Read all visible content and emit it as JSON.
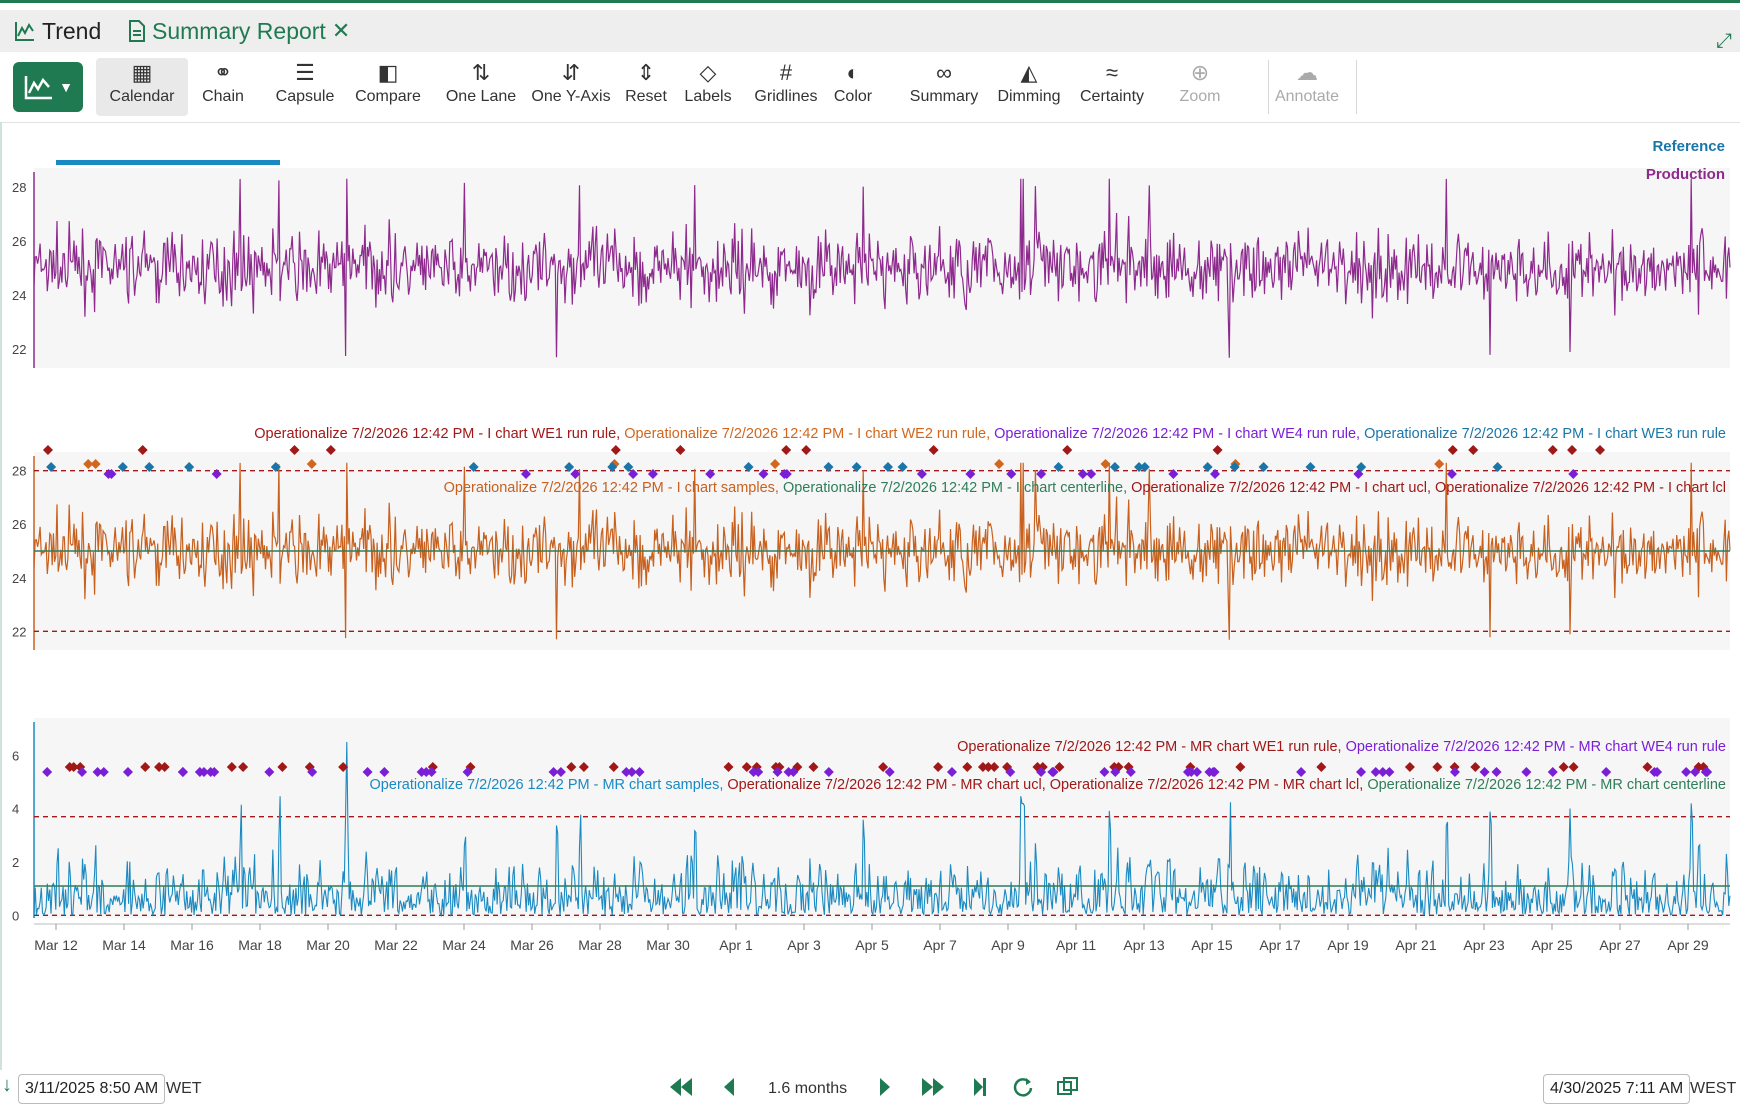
{
  "tabs": [
    {
      "label": "Trend"
    },
    {
      "label": "Summary Report"
    }
  ],
  "toolbar": {
    "items": [
      {
        "label": "Calendar",
        "icon": "calendar-icon"
      },
      {
        "label": "Chain",
        "icon": "chain-icon"
      },
      {
        "label": "Capsule",
        "icon": "capsule-icon"
      },
      {
        "label": "Compare",
        "icon": "compare-icon"
      },
      {
        "label": "One Lane",
        "icon": "one-lane-icon"
      },
      {
        "label": "One Y-Axis",
        "icon": "one-y-axis-icon"
      },
      {
        "label": "Reset",
        "icon": "reset-icon"
      },
      {
        "label": "Labels",
        "icon": "labels-icon"
      },
      {
        "label": "Gridlines",
        "icon": "gridlines-icon"
      },
      {
        "label": "Color",
        "icon": "color-icon"
      },
      {
        "label": "Summary",
        "icon": "summary-icon"
      },
      {
        "label": "Dimming",
        "icon": "dimming-icon"
      },
      {
        "label": "Certainty",
        "icon": "certainty-icon"
      },
      {
        "label": "Zoom",
        "icon": "zoom-icon"
      },
      {
        "label": "Annotate",
        "icon": "annotate-icon"
      }
    ]
  },
  "trend": {
    "reference_label": "Reference",
    "production_label": "Production"
  },
  "lanes": {
    "i_legend_top": [
      {
        "text": "Operationalize 7/2/2026 12:42 PM - I chart WE1 run rule,",
        "color": "#a01818"
      },
      {
        "text": " Operationalize 7/2/2026 12:42 PM - I chart WE2 run rule,",
        "color": "#d2661c"
      },
      {
        "text": " Operationalize 7/2/2026 12:42 PM - I chart WE4 run rule,",
        "color": "#7a1fd6"
      },
      {
        "text": " Operationalize 7/2/2026 12:42 PM - I chart WE3 run rule",
        "color": "#1a76a8"
      }
    ],
    "i_legend_bottom": [
      {
        "text": "Operationalize 7/2/2026 12:42 PM - I chart samples,",
        "color": "#c8601e"
      },
      {
        "text": " Operationalize 7/2/2026 12:42 PM - I chart centerline,",
        "color": "#2f7d5a"
      },
      {
        "text": " Operationalize 7/2/2026 12:42 PM - I chart ucl,",
        "color": "#a01818"
      },
      {
        "text": " Operationalize 7/2/2026 12:42 PM - I chart lcl",
        "color": "#a01818"
      }
    ],
    "mr_legend_top": [
      {
        "text": "Operationalize 7/2/2026 12:42 PM - MR chart WE1 run rule,",
        "color": "#a01818"
      },
      {
        "text": " Operationalize 7/2/2026 12:42 PM - MR chart WE4 run rule",
        "color": "#7a1fd6"
      }
    ],
    "mr_legend_bottom": [
      {
        "text": "Operationalize 7/2/2026 12:42 PM - MR chart samples,",
        "color": "#1a8ac2"
      },
      {
        "text": " Operationalize 7/2/2026 12:42 PM - MR chart ucl,",
        "color": "#a01818"
      },
      {
        "text": " Operationalize 7/2/2026 12:42 PM - MR chart lcl,",
        "color": "#a01818"
      },
      {
        "text": " Operationalize 7/2/2026 12:42 PM - MR chart centerline",
        "color": "#2f7d5a"
      }
    ]
  },
  "chart_data": [
    {
      "type": "line",
      "series": [
        {
          "name": "Production",
          "color": "#8e2a8e",
          "center": 25,
          "spread": 3.2,
          "min": 21,
          "max": 28.2
        }
      ],
      "ylim": [
        21.3,
        28.7
      ],
      "yticks": [
        22,
        24,
        26,
        28
      ]
    },
    {
      "type": "line",
      "series": [
        {
          "name": "Operationalize 7/2/2026 12:42 PM - I chart samples",
          "color": "#c8601e",
          "center": 25,
          "spread": 3.2,
          "min": 21,
          "max": 28.2
        }
      ],
      "ylim": [
        21.3,
        28.7
      ],
      "yticks": [
        22,
        24,
        26,
        28
      ],
      "centerline": 25,
      "ucl": 28,
      "lcl": 22
    },
    {
      "type": "line",
      "series": [
        {
          "name": "Operationalize 7/2/2026 12:42 PM - MR chart samples",
          "color": "#1a8ac2",
          "max": 6.5
        }
      ],
      "ylim": [
        -0.1,
        7.4
      ],
      "yticks": [
        0,
        2,
        4,
        6
      ],
      "centerline": 1.1,
      "ucl": 3.7,
      "lcl": 0
    }
  ],
  "x_axis": {
    "ticks": [
      "Mar 12",
      "Mar 14",
      "Mar 16",
      "Mar 18",
      "Mar 20",
      "Mar 22",
      "Mar 24",
      "Mar 26",
      "Mar 28",
      "Mar 30",
      "Apr 1",
      "Apr 3",
      "Apr 5",
      "Apr 7",
      "Apr 9",
      "Apr 11",
      "Apr 13",
      "Apr 15",
      "Apr 17",
      "Apr 19",
      "Apr 21",
      "Apr 23",
      "Apr 25",
      "Apr 27",
      "Apr 29"
    ]
  },
  "footer": {
    "start": "3/11/2025 8:50 AM",
    "start_tz": "WET",
    "duration": "1.6 months",
    "end": "4/30/2025 7:11 AM",
    "end_tz": "WEST"
  }
}
